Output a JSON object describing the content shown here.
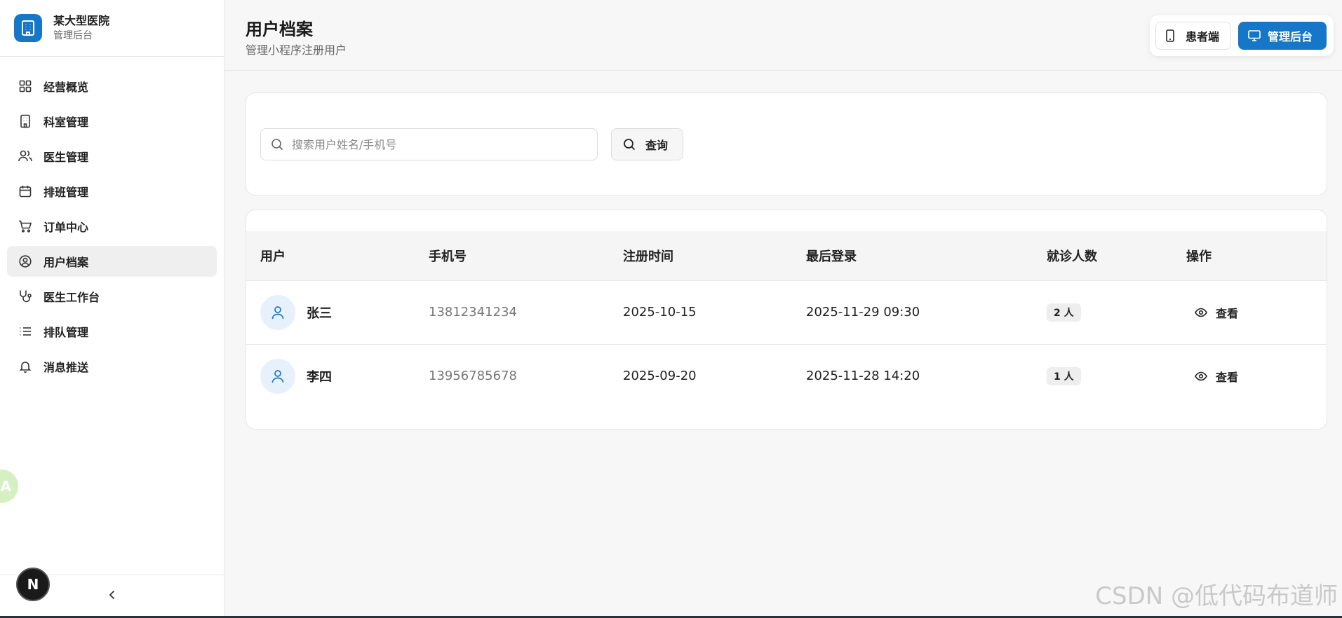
{
  "brand": {
    "name": "某大型医院",
    "subtitle": "管理后台"
  },
  "sidebar": {
    "items": [
      {
        "label": "经营概览",
        "icon": "dashboard-icon"
      },
      {
        "label": "科室管理",
        "icon": "building-icon"
      },
      {
        "label": "医生管理",
        "icon": "users-icon"
      },
      {
        "label": "排班管理",
        "icon": "calendar-icon"
      },
      {
        "label": "订单中心",
        "icon": "cart-icon"
      },
      {
        "label": "用户档案",
        "icon": "user-circle-icon",
        "active": true
      },
      {
        "label": "医生工作台",
        "icon": "stethoscope-icon"
      },
      {
        "label": "排队管理",
        "icon": "list-icon"
      },
      {
        "label": "消息推送",
        "icon": "bell-icon"
      }
    ]
  },
  "header": {
    "title": "用户档案",
    "subtitle": "管理小程序注册用户",
    "switch_patient": "患者端",
    "switch_admin": "管理后台"
  },
  "search": {
    "placeholder": "搜索用户姓名/手机号",
    "value": "",
    "button_label": "查询"
  },
  "table": {
    "columns": [
      "用户",
      "手机号",
      "注册时间",
      "最后登录",
      "就诊人数",
      "操作"
    ],
    "rows": [
      {
        "name": "张三",
        "phone": "13812341234",
        "registered": "2025-10-15",
        "last_login": "2025-11-29 09:30",
        "patients": "2 人",
        "action": "查看"
      },
      {
        "name": "李四",
        "phone": "13956785678",
        "registered": "2025-09-20",
        "last_login": "2025-11-28 14:20",
        "patients": "1 人",
        "action": "查看"
      }
    ]
  },
  "floating": {
    "badge_letter": "N",
    "translate_glyph": "A"
  },
  "watermark": "CSDN @低代码布道师",
  "colors": {
    "primary": "#1677c9",
    "active_nav_bg": "#efefef",
    "avatar_bg": "#e6f1fb"
  }
}
